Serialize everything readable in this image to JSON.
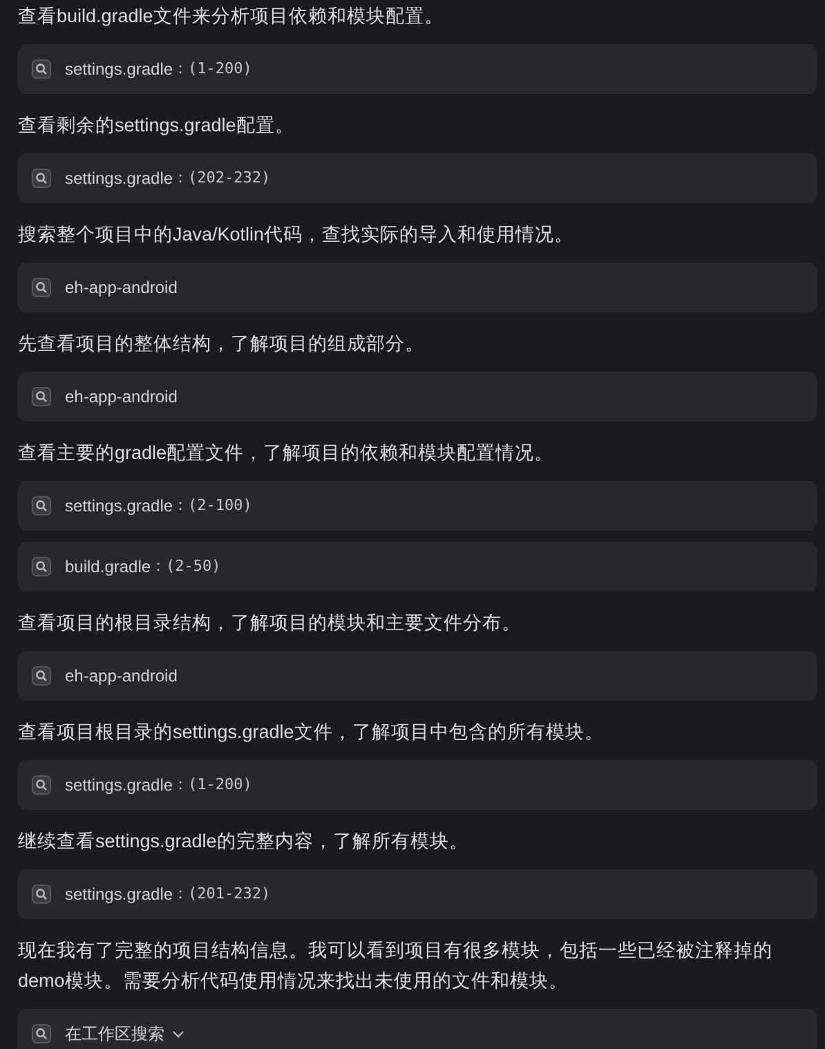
{
  "items": [
    {
      "kind": "text",
      "text": "查看build.gradle文件来分析项目依赖和模块配置。"
    },
    {
      "kind": "tool",
      "label": "settings.gradle",
      "range": "：(1-200)"
    },
    {
      "kind": "text",
      "text": "查看剩余的settings.gradle配置。"
    },
    {
      "kind": "tool",
      "label": "settings.gradle",
      "range": "：(202-232)"
    },
    {
      "kind": "text",
      "text": "搜索整个项目中的Java/Kotlin代码，查找实际的导入和使用情况。"
    },
    {
      "kind": "tool",
      "label": "eh-app-android"
    },
    {
      "kind": "text",
      "text": "先查看项目的整体结构，了解项目的组成部分。"
    },
    {
      "kind": "tool",
      "label": "eh-app-android"
    },
    {
      "kind": "text",
      "text": "查看主要的gradle配置文件，了解项目的依赖和模块配置情况。"
    },
    {
      "kind": "tool",
      "label": "settings.gradle",
      "range": "：(2-100)"
    },
    {
      "kind": "tool",
      "label": "build.gradle",
      "range": "：(2-50)"
    },
    {
      "kind": "text",
      "text": "查看项目的根目录结构，了解项目的模块和主要文件分布。"
    },
    {
      "kind": "tool",
      "label": "eh-app-android"
    },
    {
      "kind": "text",
      "text": "查看项目根目录的settings.gradle文件，了解项目中包含的所有模块。"
    },
    {
      "kind": "tool",
      "label": "settings.gradle",
      "range": "：(1-200)"
    },
    {
      "kind": "text",
      "text": "继续查看settings.gradle的完整内容，了解所有模块。"
    },
    {
      "kind": "tool",
      "label": "settings.gradle",
      "range": "：(201-232)"
    },
    {
      "kind": "text",
      "text": "现在我有了完整的项目结构信息。我可以看到项目有很多模块，包括一些已经被注释掉的demo模块。需要分析代码使用情况来找出未使用的文件和模块。"
    },
    {
      "kind": "dropdown",
      "label": "在工作区搜索"
    }
  ]
}
